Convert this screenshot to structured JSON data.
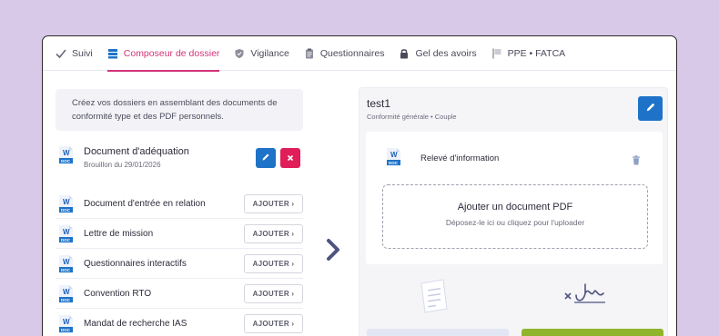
{
  "tabs": [
    {
      "label": "Suivi",
      "icon": "check-icon"
    },
    {
      "label": "Composeur de dossier",
      "icon": "folder-stack-icon",
      "active": true
    },
    {
      "label": "Vigilance",
      "icon": "shield-icon"
    },
    {
      "label": "Questionnaires",
      "icon": "clipboard-icon"
    },
    {
      "label": "Gel des avoirs",
      "icon": "lock-icon"
    },
    {
      "label": "PPE • FATCA",
      "icon": "flag-icon"
    }
  ],
  "intro": "Créez vos dossiers en assemblant des documents de conformité type et des PDF personnels.",
  "featured": {
    "title": "Document d'adéquation",
    "date": "Brouillon du 29/01/2026"
  },
  "add_label": "AJOUTER ›",
  "documents": [
    "Document d'entrée en relation",
    "Lettre de mission",
    "Questionnaires interactifs",
    "Convention RTO",
    "Mandat de recherche IAS"
  ],
  "dossier": {
    "title": "test1",
    "subtitle": "Conformité générale • Couple",
    "item": "Relevé d'information",
    "drop_title": "Ajouter un document PDF",
    "drop_hint": "Déposez-le ici ou cliquez pour l'uploader"
  },
  "doc_badge": "DOC",
  "colors": {
    "accent": "#d4317a",
    "primary": "#1e73c8",
    "danger": "#e01e5a",
    "success": "#8fb52c"
  }
}
